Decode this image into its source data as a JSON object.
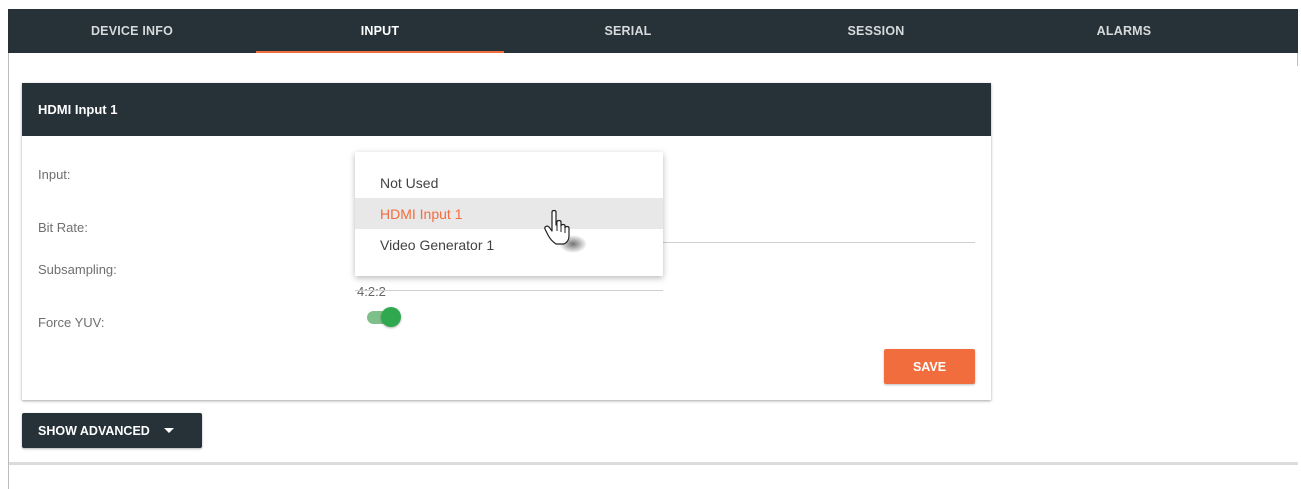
{
  "tabs": [
    {
      "label": "DEVICE INFO",
      "active": false
    },
    {
      "label": "INPUT",
      "active": true
    },
    {
      "label": "SERIAL",
      "active": false
    },
    {
      "label": "SESSION",
      "active": false
    },
    {
      "label": "ALARMS",
      "active": false
    }
  ],
  "card": {
    "title": "HDMI Input 1",
    "fields": {
      "input_label": "Input:",
      "bitrate_label": "Bit Rate:",
      "subsampling_label": "Subsampling:",
      "subsampling_value": "4:2:2",
      "forceyuv_label": "Force YUV:",
      "forceyuv_on": true
    },
    "save_label": "SAVE"
  },
  "dropdown": {
    "options": [
      "Not Used",
      "HDMI Input 1",
      "Video Generator 1"
    ],
    "selected": "HDMI Input 1"
  },
  "advanced_label": "SHOW ADVANCED",
  "colors": {
    "nav_bg": "#263238",
    "accent": "#f26d3d",
    "toggle_on": "#2fa84f"
  },
  "icons": {
    "advanced_caret": "caret-down-icon",
    "cursor": "hand-pointer-icon"
  }
}
